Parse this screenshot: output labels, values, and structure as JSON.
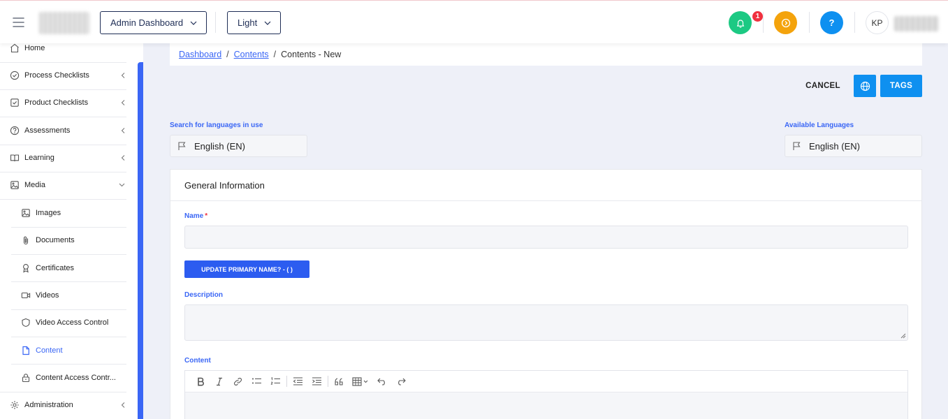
{
  "header": {
    "dashboard_select": "Admin Dashboard",
    "theme_select": "Light",
    "notification_count": "1",
    "help_label": "?",
    "user_initials": "KP",
    "colors": {
      "notify": "#1cc983",
      "coin": "#f4a30c",
      "help": "#0e90f0"
    }
  },
  "sidebar": {
    "items": [
      {
        "label": "Home",
        "icon": "home-icon"
      },
      {
        "label": "Process Checklists",
        "icon": "check-circle-icon"
      },
      {
        "label": "Product Checklists",
        "icon": "check-square-icon"
      },
      {
        "label": "Assessments",
        "icon": "question-circle-icon"
      },
      {
        "label": "Learning",
        "icon": "book-icon"
      },
      {
        "label": "Media",
        "icon": "image-icon"
      },
      {
        "label": "Administration",
        "icon": "gear-icon"
      }
    ],
    "media_sub": [
      {
        "label": "Images",
        "icon": "image-icon"
      },
      {
        "label": "Documents",
        "icon": "paperclip-icon"
      },
      {
        "label": "Certificates",
        "icon": "award-icon"
      },
      {
        "label": "Videos",
        "icon": "video-icon"
      },
      {
        "label": "Video Access Control",
        "icon": "shield-icon"
      },
      {
        "label": "Content",
        "icon": "file-icon"
      },
      {
        "label": "Content Access Contr...",
        "icon": "lock-icon"
      }
    ]
  },
  "breadcrumb": {
    "items": [
      "Dashboard",
      "Contents",
      "Contents - New"
    ],
    "separator": "/"
  },
  "actions": {
    "cancel": "CANCEL",
    "tags": "TAGS"
  },
  "languages": {
    "search_label": "Search for languages in use",
    "search_value": "English (EN)",
    "available_label": "Available Languages",
    "available_value": "English (EN)"
  },
  "form": {
    "section_title": "General Information",
    "name_label": "Name",
    "required_mark": "*",
    "update_button": "UPDATE PRIMARY NAME? - ( )",
    "description_label": "Description",
    "content_label": "Content"
  },
  "colors": {
    "accent": "#3a66f5",
    "primary_button": "#2c5cf0",
    "action_button": "#0e90f0",
    "badge": "#f0313f"
  }
}
